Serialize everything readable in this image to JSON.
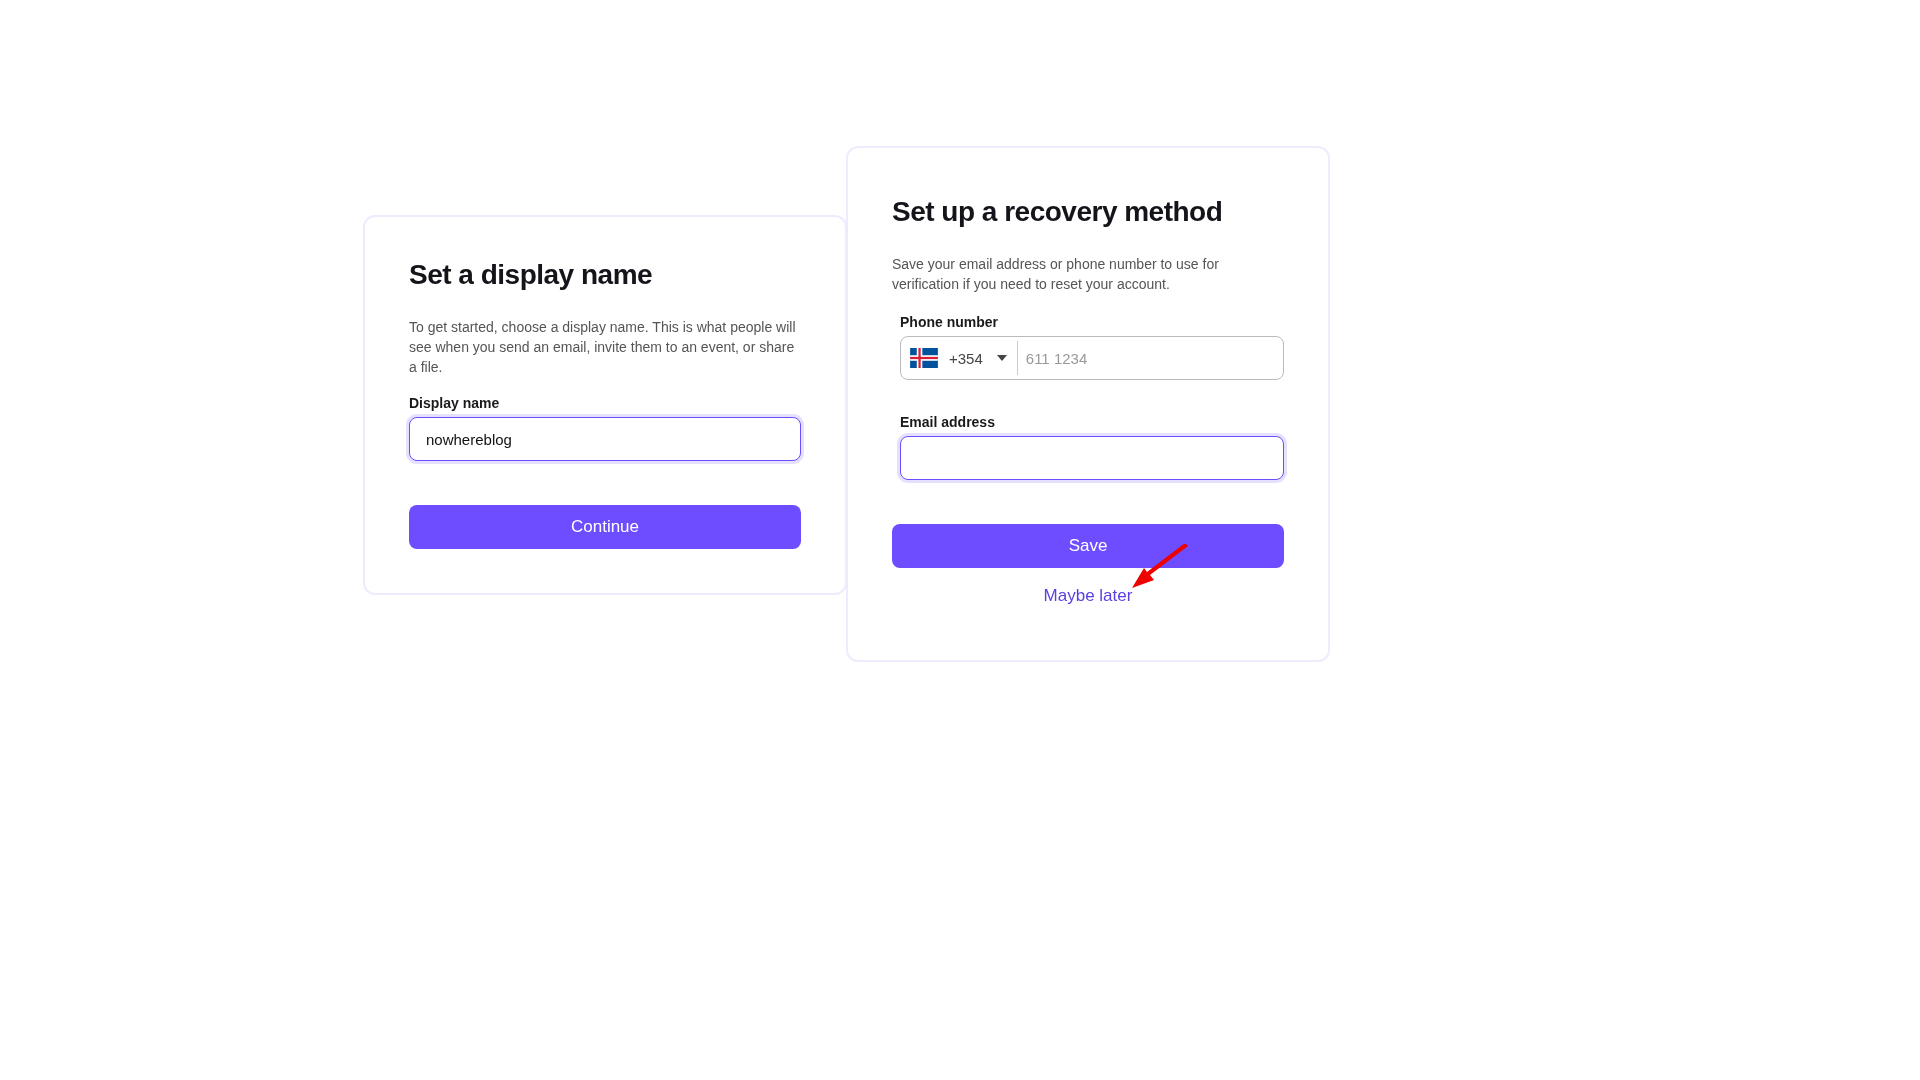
{
  "display_name_card": {
    "title": "Set a display name",
    "description": "To get started, choose a display name. This is what people will see when you send an email, invite them to an event, or share a file.",
    "field": {
      "label": "Display name",
      "value": "nowhereblog",
      "focused": true
    },
    "button": "Continue"
  },
  "recovery_card": {
    "title": "Set up a recovery method",
    "description": "Save your email address or phone number to use for verification if you need to reset your account.",
    "phone": {
      "label": "Phone number",
      "country_code": "+354",
      "placeholder": "611 1234",
      "focused": false
    },
    "email": {
      "label": "Email address",
      "focused": true
    },
    "button": "Save",
    "link": "Maybe later"
  }
}
